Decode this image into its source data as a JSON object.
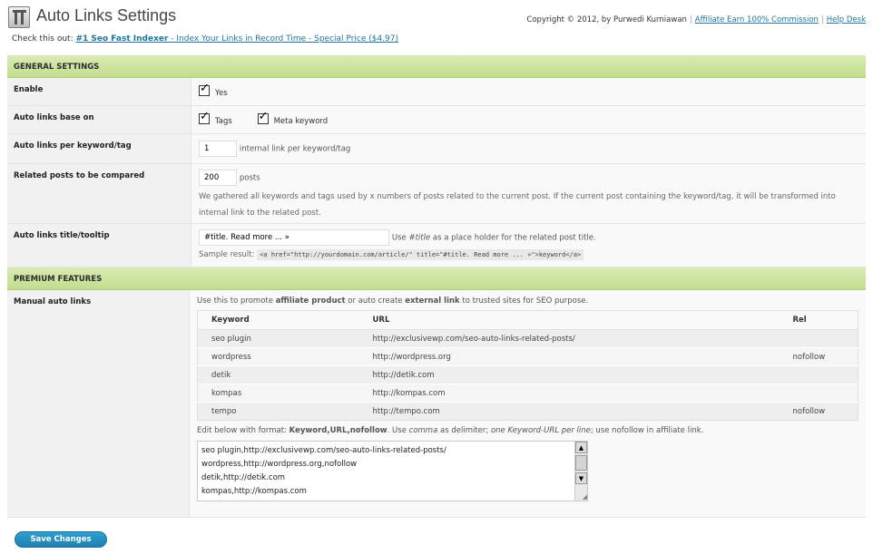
{
  "header": {
    "title": "Auto Links Settings",
    "copyright": "Copyright © 2012, by Purwedi Kurniawan",
    "links": [
      {
        "label": "Affiliate Earn 100% Commission"
      },
      {
        "label": "Help Desk"
      }
    ]
  },
  "promo": {
    "prefix": "Check this out: ",
    "link_strong": "#1 Seo Fast Indexer",
    "link_rest": " - Index Your Links in Record Time - Special Price ($4.97)"
  },
  "general": {
    "heading": "GENERAL SETTINGS",
    "enable": {
      "label": "Enable",
      "option": "Yes",
      "checked": true
    },
    "base_on": {
      "label": "Auto links base on",
      "options": [
        {
          "label": "Tags",
          "checked": true
        },
        {
          "label": "Meta keyword",
          "checked": true
        }
      ]
    },
    "per_keyword": {
      "label": "Auto links per keyword/tag",
      "value": "1",
      "hint": "internal link per keyword/tag"
    },
    "related": {
      "label": "Related posts to be compared",
      "value": "200",
      "hint": "posts",
      "desc": "We gathered all keywords and tags used by x numbers of posts related to the current post. If the current post containing the keyword/tag, it will be transformed into internal link to the related post."
    },
    "tooltip": {
      "label": "Auto links title/tooltip",
      "value": "#title. Read more ... »",
      "hint_pre": "Use ",
      "hint_em": "#title",
      "hint_post": " as a place holder for the related post title.",
      "sample_label": "Sample result: ",
      "sample_code": "<a href=\"http://yourdomain.com/article/\" title=\"#title. Read more ... »\">keyword</a>"
    }
  },
  "premium": {
    "heading": "PREMIUM FEATURES",
    "manual": {
      "label": "Manual auto links",
      "intro_pre": "Use this to promote ",
      "intro_b1": "affiliate product",
      "intro_mid": " or auto create ",
      "intro_b2": "external link",
      "intro_post": " to trusted sites for SEO purpose.",
      "columns": [
        "Keyword",
        "URL",
        "Rel"
      ],
      "rows": [
        {
          "keyword": "seo plugin",
          "url": "http://exclusivewp.com/seo-auto-links-related-posts/",
          "rel": ""
        },
        {
          "keyword": "wordpress",
          "url": "http://wordpress.org",
          "rel": "nofollow"
        },
        {
          "keyword": "detik",
          "url": "http://detik.com",
          "rel": ""
        },
        {
          "keyword": "kompas",
          "url": "http://kompas.com",
          "rel": ""
        },
        {
          "keyword": "tempo",
          "url": "http://tempo.com",
          "rel": "nofollow"
        }
      ],
      "edit_pre": "Edit below with format: ",
      "edit_format": "Keyword,URL,nofollow",
      "edit_mid1": ". Use ",
      "edit_em1": "comma",
      "edit_mid2": " as delimiter; ",
      "edit_em2": "one Keyword-URL per line",
      "edit_post": "; use nofollow in affiliate link.",
      "textarea_lines": [
        "seo plugin,http://exclusivewp.com/seo-auto-links-related-posts/",
        "wordpress,http://wordpress.org,nofollow",
        "detik,http://detik.com",
        "kompas,http://kompas.com"
      ]
    }
  },
  "save_label": "Save Changes",
  "colors": {
    "section_green": "#c9e09a",
    "button_blue": "#2a8fc4",
    "link": "#21759b"
  }
}
